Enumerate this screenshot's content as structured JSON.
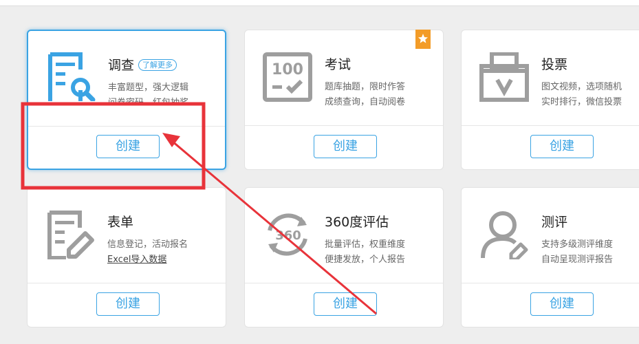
{
  "cards": [
    {
      "title": "调查",
      "learn_more": "了解更多",
      "desc1": "丰富题型，强大逻辑",
      "desc2": "问卷密码，红包抽奖",
      "button": "创建"
    },
    {
      "title": "考试",
      "desc1": "题库抽题，限时作答",
      "desc2": "成绩查询，自动阅卷",
      "button": "创建",
      "icon_text": "100"
    },
    {
      "title": "投票",
      "desc1": "图文视频，选项随机",
      "desc2": "实时排行，微信投票",
      "button": "创建"
    },
    {
      "title": "表单",
      "desc1": "信息登记，活动报名",
      "desc2": "Excel导入数据",
      "button": "创建"
    },
    {
      "title": "360度评估",
      "desc1": "批量评估，权重维度",
      "desc2": "便捷发放，个人报告",
      "button": "创建",
      "icon_text": "360"
    },
    {
      "title": "测评",
      "desc1": "支持多级测评维度",
      "desc2": "自动呈现测评报告",
      "button": "创建"
    }
  ],
  "colors": {
    "accent": "#3aa3e3",
    "icon_gray": "#9e9e9e",
    "annotation_red": "#e8333a",
    "badge_orange": "#f39c28"
  }
}
